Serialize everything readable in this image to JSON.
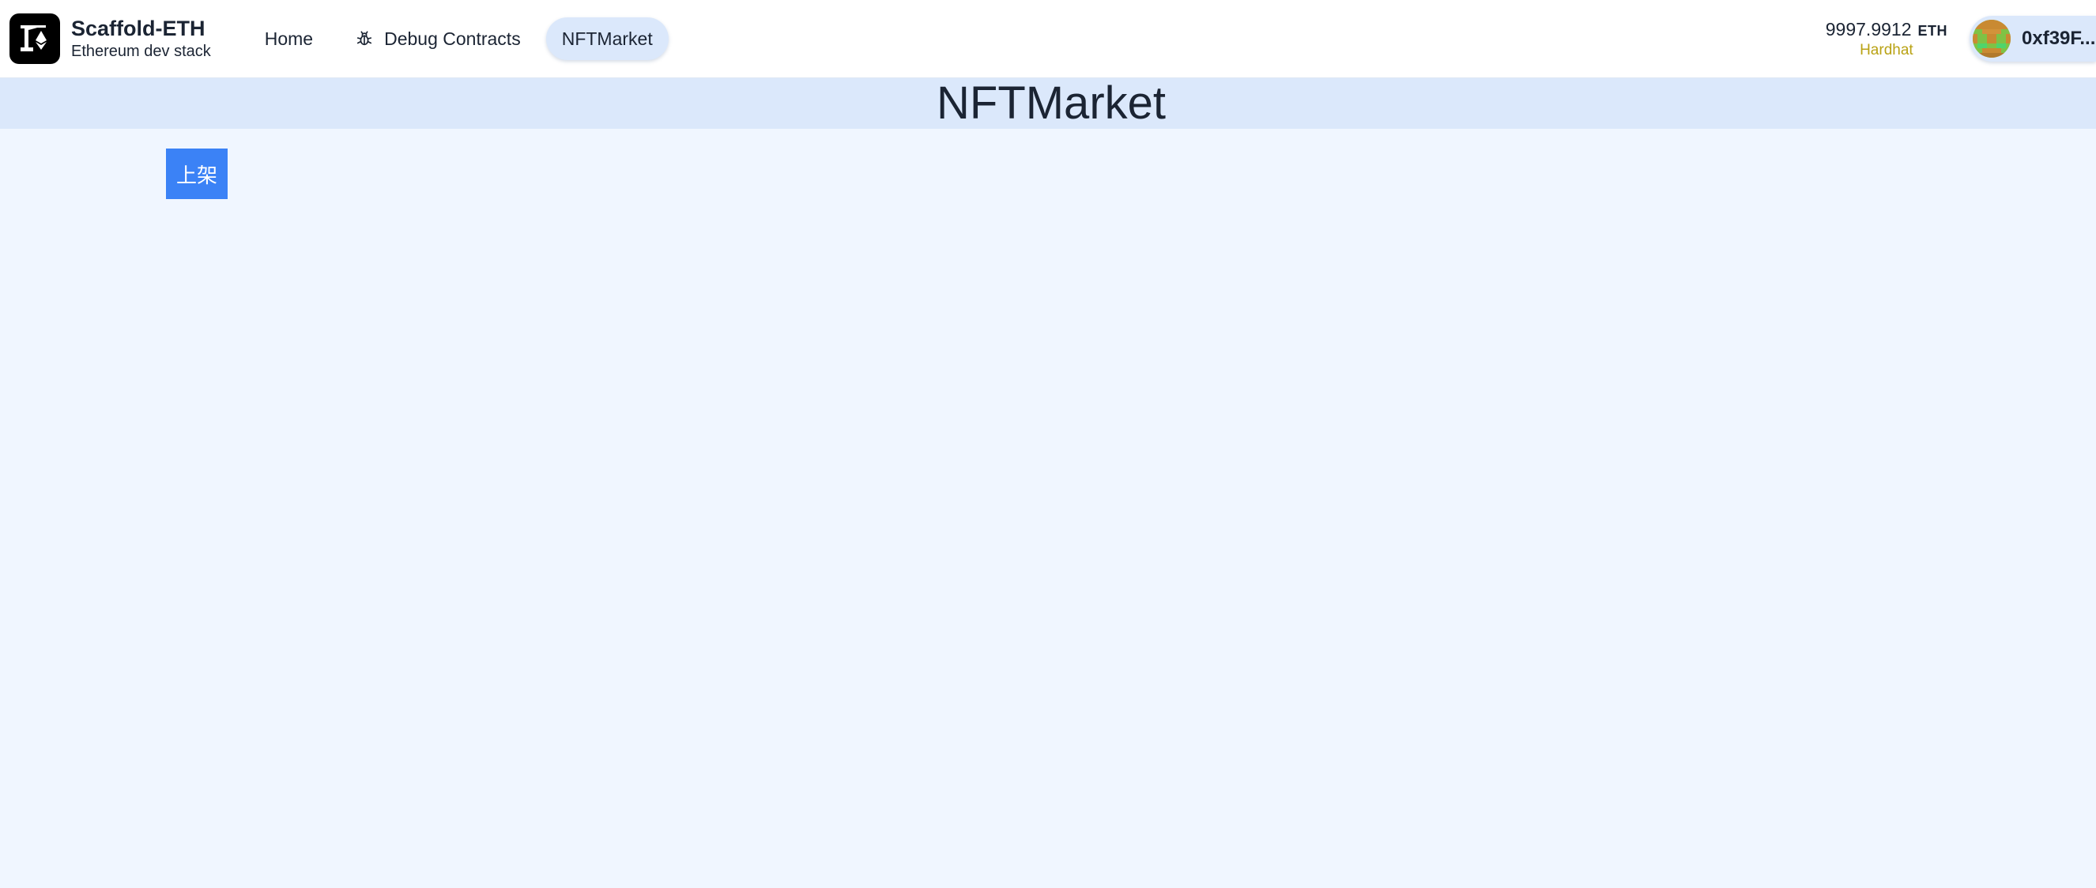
{
  "header": {
    "app_title": "Scaffold-ETH",
    "app_subtitle": "Ethereum dev stack",
    "logo_icon": "scaffold-eth-logo-icon",
    "nav": [
      {
        "label": "Home",
        "icon": ""
      },
      {
        "label": "Debug Contracts",
        "icon": "bug-icon"
      },
      {
        "label": "NFTMarket",
        "icon": "",
        "active": true
      }
    ],
    "balance": {
      "amount": "9997.9912",
      "unit": "ETH",
      "network": "Hardhat"
    },
    "account": {
      "address": "0xf39F..."
    }
  },
  "page": {
    "title": "NFTMarket",
    "list_button_label": "上架"
  },
  "colors": {
    "accent": "#3b82f6",
    "nav_active_bg": "#dbe8fb",
    "page_bg": "#f0f6ff",
    "network": "#b9a214"
  }
}
